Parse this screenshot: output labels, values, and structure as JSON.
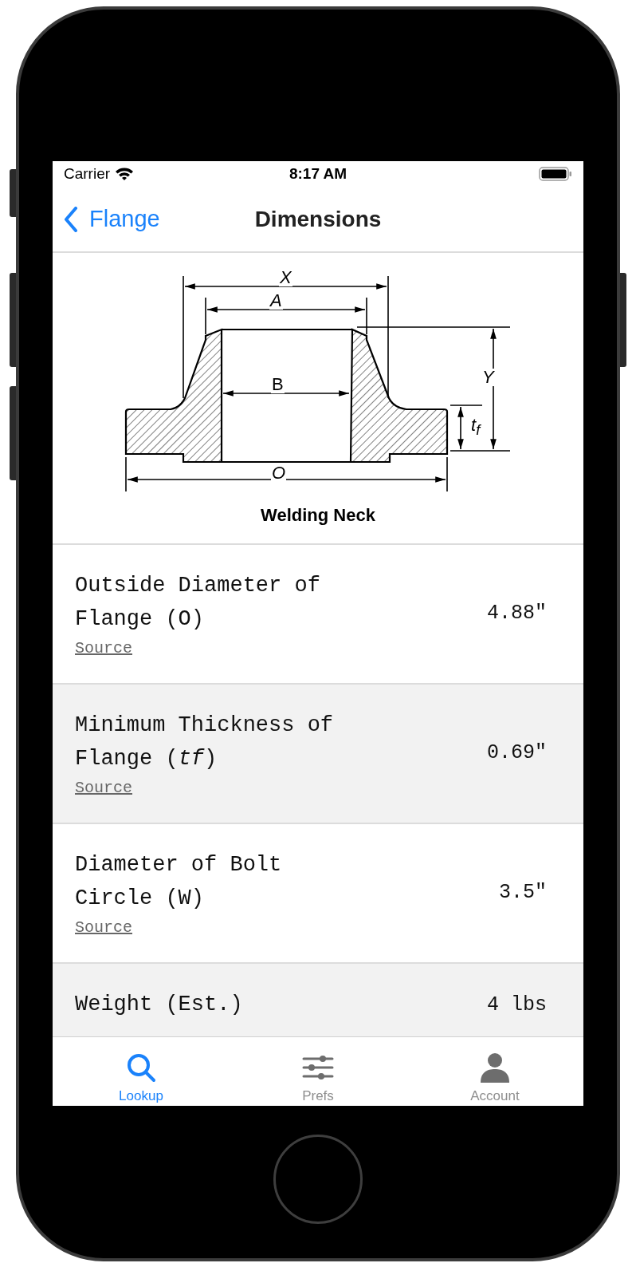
{
  "status_bar": {
    "carrier": "Carrier",
    "time": "8:17 AM"
  },
  "nav": {
    "back": "Flange",
    "title": "Dimensions"
  },
  "diagram": {
    "labels": {
      "x": "X",
      "a": "A",
      "b": "B",
      "y": "Y",
      "o": "O",
      "tf": "t$_{f}$"
    },
    "caption": "Welding Neck"
  },
  "rows": [
    {
      "label": "Outside Diameter of Flange (O)",
      "value": "4.88\"",
      "link": "Source"
    },
    {
      "label": "Minimum Thickness of Flange (*tf*)",
      "value": "0.69\"",
      "link": "Source"
    },
    {
      "label": "Diameter of Bolt Circle (W)",
      "value": "3.5\"",
      "link": "Source"
    },
    {
      "label": "Weight (Est.)",
      "value": "4 lbs"
    }
  ],
  "tabs": [
    {
      "label": "Lookup",
      "kind": "search",
      "selected": true
    },
    {
      "label": "Prefs",
      "kind": "sliders",
      "selected": false
    },
    {
      "label": "Account",
      "kind": "person",
      "selected": false
    }
  ]
}
